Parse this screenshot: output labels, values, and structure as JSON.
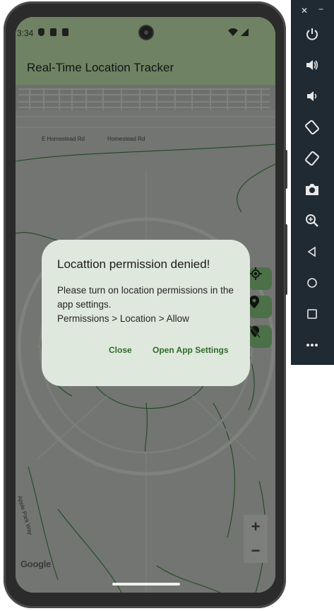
{
  "status_bar": {
    "time": "3:34"
  },
  "app_bar": {
    "title": "Real-Time Location Tracker"
  },
  "map": {
    "street_labels": [
      "E Homestead Rd",
      "Homestead Rd",
      "Apple Park Way"
    ],
    "logo": "Google",
    "zoom_in_label": "+",
    "zoom_out_label": "−"
  },
  "dialog": {
    "title": "Locattion permission denied!",
    "body_line1": "Please turn on location permissions in the app settings.",
    "body_line2": "Permissions > Location > Allow",
    "close_label": "Close",
    "settings_label": "Open App Settings"
  },
  "emulator": {
    "close_glyph": "✕",
    "minimize_glyph": "−",
    "buttons": [
      "power-icon",
      "volume-up-icon",
      "volume-down-icon",
      "rotate-left-icon",
      "rotate-right-icon",
      "camera-icon",
      "zoom-icon",
      "back-icon",
      "home-icon",
      "overview-icon",
      "more-icon"
    ]
  },
  "colors": {
    "app_bar": "#6f8263",
    "dialog_bg": "#dfe8dc",
    "accent": "#2f6b2b",
    "fab": "#4c7047"
  }
}
